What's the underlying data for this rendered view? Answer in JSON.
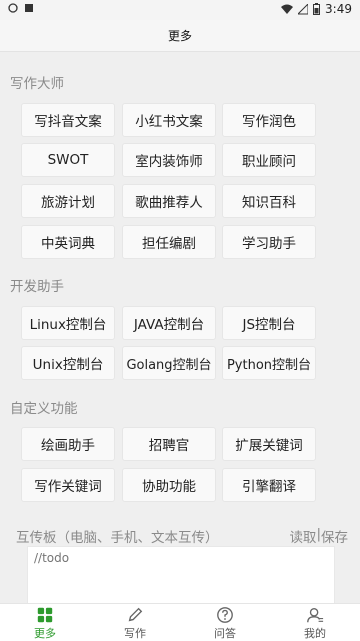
{
  "status": {
    "time": "3:49"
  },
  "header": {
    "title": "更多"
  },
  "sections": {
    "writing_master": {
      "title": "写作大师",
      "buttons": [
        "写抖音文案",
        "小红书文案",
        "写作润色",
        "SWOT",
        "室内装饰师",
        "职业顾问",
        "旅游计划",
        "歌曲推荐人",
        "知识百科",
        "中英词典",
        "担任编剧",
        "学习助手"
      ]
    },
    "dev_assistant": {
      "title": "开发助手",
      "buttons": [
        "Linux控制台",
        "JAVA控制台",
        "JS控制台",
        "Unix控制台",
        "Golang控制台",
        "Python控制台"
      ]
    },
    "custom_functions": {
      "title": "自定义功能",
      "buttons": [
        "绘画助手",
        "招聘官",
        "扩展关键词",
        "写作关键词",
        "协助功能",
        "引擎翻译"
      ]
    }
  },
  "mutual_transfer": {
    "label": "互传板（电脑、手机、文本互传）",
    "read_label": "读取",
    "separator": "|",
    "save_label": "保存",
    "placeholder": "//todo"
  },
  "tabs": [
    {
      "label": "更多",
      "icon": "grid-icon",
      "active": true
    },
    {
      "label": "写作",
      "icon": "pencil-icon",
      "active": false
    },
    {
      "label": "问答",
      "icon": "question-icon",
      "active": false
    },
    {
      "label": "我的",
      "icon": "user-icon",
      "active": false
    }
  ],
  "colors": {
    "accent": "#2d9a2d",
    "background": "#efefef"
  }
}
